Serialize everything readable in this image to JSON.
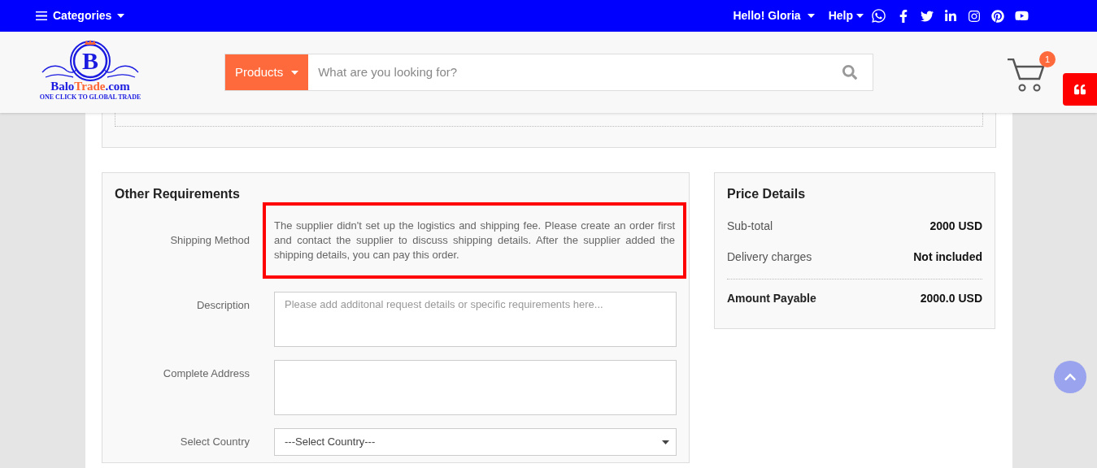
{
  "top_bar": {
    "categories": "Categories",
    "greeting": "Hello! Gloria",
    "help": "Help"
  },
  "header": {
    "logo": {
      "letter": "B",
      "name_part1": "Balo",
      "name_part2": "Trade",
      "name_part3": ".com",
      "tagline": "ONE CLICK TO GLOBAL TRADE"
    },
    "search": {
      "category": "Products",
      "placeholder": "What are you looking for?"
    },
    "cart_count": "1"
  },
  "other_requirements": {
    "title": "Other Requirements",
    "fields": [
      {
        "kind": "note",
        "label": "Shipping Method",
        "text": "The supplier didn't set up the logistics and shipping fee. Please create an order first and contact the supplier to discuss shipping details. After the supplier added the shipping details, you can pay this order.",
        "highlighted": true
      },
      {
        "kind": "textarea",
        "label": "Description",
        "placeholder": "Please add additonal request details or specific requirements here..."
      },
      {
        "kind": "textarea",
        "label": "Complete Address"
      },
      {
        "kind": "select",
        "label": "Select Country",
        "value": "---Select Country---"
      }
    ]
  },
  "price_details": {
    "title": "Price Details",
    "rows": [
      {
        "label": "Sub-total",
        "value": "2000 USD",
        "total": false
      },
      {
        "label": "Delivery charges",
        "value": "Not included",
        "total": false
      },
      {
        "label": "Amount Payable",
        "value": "2000.0 USD",
        "total": true
      }
    ]
  }
}
